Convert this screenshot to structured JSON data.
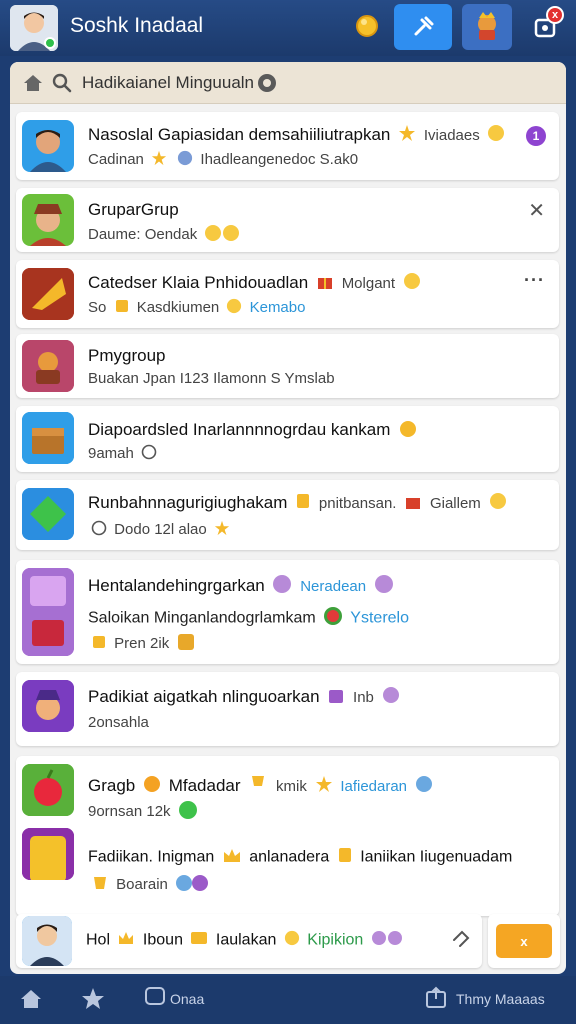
{
  "app": {
    "title": "Soshk Inadaal",
    "notif_badge": "x"
  },
  "search": {
    "text": "Hadikaianel Minguualn"
  },
  "messages": [
    {
      "name": "Nasoslal Gapiasidan demsahiiliutrapkan",
      "tag": "Iviadaes",
      "badge": "1",
      "sub": "Cadinan",
      "sub2": "Ihadleangenedoc S.ak0"
    },
    {
      "name": "GruparGrup",
      "sub": "Daume: Oendak"
    },
    {
      "name": "Catedser Klaia Pnhidouadlan",
      "tag": "Molgant",
      "sub": "So",
      "sub2": "Kasdkiumen",
      "sub3": "Kemabo"
    },
    {
      "name": "Pmygroup",
      "sub": "Buakan Jpan I123 Ilamonn S Ymslab"
    },
    {
      "name": "Diapoardsled Inarlannnnogrdau kankam",
      "sub": "9amah"
    },
    {
      "name": "Runbahnnagurigiughakam",
      "tag": "pnitbansan.",
      "tag2": "Giallem",
      "sub": "Dodo 12l alao"
    },
    {
      "name": "Hentalandehingrgarkan",
      "tag": "Neradean",
      "sub": "Saloikan Minganlandogrlamkam",
      "sub_tag": "Ysterelo",
      "sub2": "Pren 2ik"
    },
    {
      "name": "Padikiat aigatkah nlinguoarkan",
      "tag": "Inb",
      "sub": "2onsahla"
    },
    {
      "name": "Gragb",
      "name2": "Mfadadar",
      "name3": "kmik",
      "tag": "Iafiedaran",
      "sub": "9ornsan 12k"
    },
    {
      "name": "Fadiikan. Inigman",
      "name2": "anlanadera",
      "name3": "Ianiikan Iiugenuadam",
      "sub": "Boarain"
    }
  ],
  "composer": {
    "text": "Hol",
    "text2": "Iboun",
    "text3": "Iaulakan",
    "tag": "Kipikion"
  },
  "send": {
    "label": "x"
  },
  "bottom_nav": {
    "center_label": "Onaa",
    "right_label": "Thmy Maaaas"
  },
  "colors": {
    "header_bg": "#1c3a6c",
    "panel_bg": "#f2f2f2",
    "search_bg": "#ece4d6",
    "accent_blue": "#2f8ef0",
    "send_orange": "#f5a623",
    "badge_purple": "#8e44d0",
    "link_blue": "#2c95d8"
  },
  "icons": {
    "top": [
      "user-avatar",
      "coin-icon",
      "tool-icon",
      "game-character-icon",
      "notification-icon"
    ],
    "search": [
      "home-icon",
      "search-icon",
      "settings-badge-icon"
    ],
    "nav": [
      "home-icon",
      "star-icon",
      "chat-icon",
      "share-icon"
    ]
  }
}
